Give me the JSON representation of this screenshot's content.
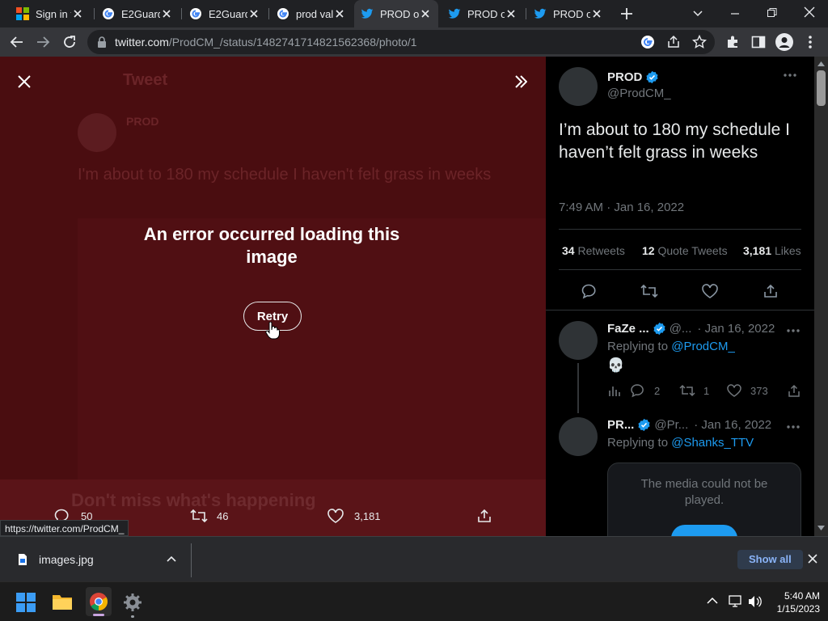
{
  "browser": {
    "tabs": [
      {
        "title": "Sign in t",
        "icon": "microsoft-icon"
      },
      {
        "title": "E2Guard",
        "icon": "google-icon"
      },
      {
        "title": "E2Guard",
        "icon": "google-icon"
      },
      {
        "title": "prod val",
        "icon": "google-icon"
      },
      {
        "title": "PROD o",
        "icon": "twitter-icon"
      },
      {
        "title": "PROD o",
        "icon": "twitter-icon"
      },
      {
        "title": "PROD o",
        "icon": "twitter-icon"
      }
    ],
    "url_host": "twitter.com",
    "url_path": "/ProdCM_/status/1482741714821562368/photo/1",
    "status_url": "https://twitter.com/ProdCM_"
  },
  "viewer": {
    "error_message": "An error occurred loading this image",
    "retry_label": "Retry",
    "ghost_header": "Tweet",
    "ghost_name": "PROD",
    "ghost_text": "I'm about to 180 my schedule I haven't felt grass in weeks",
    "ghost_footer": "Don't miss what's happening",
    "replies": "50",
    "retweets": "46",
    "likes": "3,181"
  },
  "tweet": {
    "name": "PROD",
    "handle": "@ProdCM_",
    "text": "I’m about to 180 my schedule I haven’t felt grass in weeks",
    "timestamp": "7:49 AM · Jan 16, 2022",
    "retweets_count": "34",
    "retweets_label": "Retweets",
    "quotes_count": "12",
    "quotes_label": "Quote Tweets",
    "likes_count": "3,181",
    "likes_label": "Likes"
  },
  "replies": [
    {
      "name": "FaZe ...",
      "handle": "@...",
      "date": "· Jan 16, 2022",
      "replying_prefix": "Replying to",
      "replying_to": "@ProdCM_",
      "body": "💀",
      "replies": "2",
      "retweets": "1",
      "likes": "373"
    },
    {
      "name": "PR...",
      "handle": "@Pr...",
      "date": "· Jan 16, 2022",
      "replying_prefix": "Replying to",
      "replying_to": "@Shanks_TTV",
      "media_error": "The media could not be played."
    }
  ],
  "downloads": {
    "file_name": "images.jpg",
    "show_all_label": "Show all"
  },
  "taskbar": {
    "time": "5:40 AM",
    "date": "1/15/2023"
  },
  "colors": {
    "viewer_bg": "#4a0d10",
    "twitter_blue": "#1d9bf0",
    "panel_bg": "#000000"
  }
}
